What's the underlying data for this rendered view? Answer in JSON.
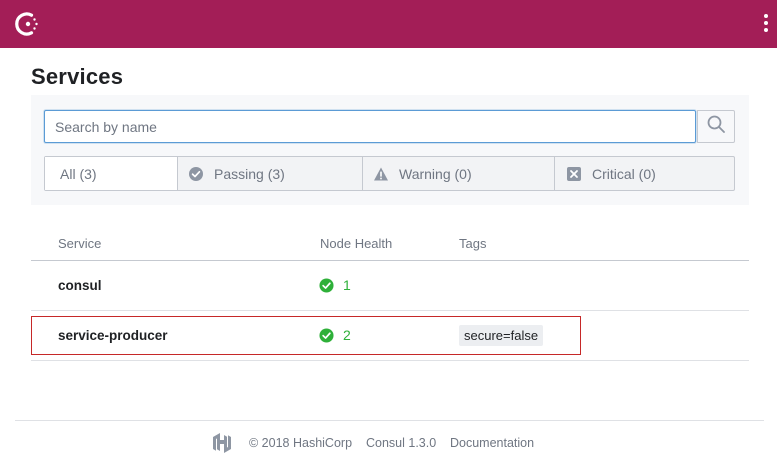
{
  "header": {
    "logo_icon": "consul-logo-icon",
    "menu_icon": "kebab-menu-icon",
    "brand_color": "#a31e57"
  },
  "page": {
    "title": "Services"
  },
  "search": {
    "placeholder": "Search by name",
    "value": "",
    "button_icon": "search-icon"
  },
  "filters": {
    "tabs": [
      {
        "label": "All (3)",
        "icon": "",
        "active": true
      },
      {
        "label": "Passing (3)",
        "icon": "check-circle-icon",
        "active": false
      },
      {
        "label": "Warning (0)",
        "icon": "warning-triangle-icon",
        "active": false
      },
      {
        "label": "Critical (0)",
        "icon": "x-square-icon",
        "active": false
      }
    ]
  },
  "table": {
    "columns": [
      "Service",
      "Node Health",
      "Tags"
    ],
    "rows": [
      {
        "name": "consul",
        "health": "1",
        "tags": []
      },
      {
        "name": "service-producer",
        "health": "2",
        "tags": [
          "secure=false"
        ]
      }
    ]
  },
  "footer": {
    "logo_icon": "hashicorp-logo-icon",
    "copyright": "© 2018 HashiCorp",
    "version": "Consul 1.3.0",
    "docs_link": "Documentation"
  },
  "colors": {
    "passing": "#2eb039",
    "highlight": "#c62828",
    "focus": "#5b9bd5"
  }
}
